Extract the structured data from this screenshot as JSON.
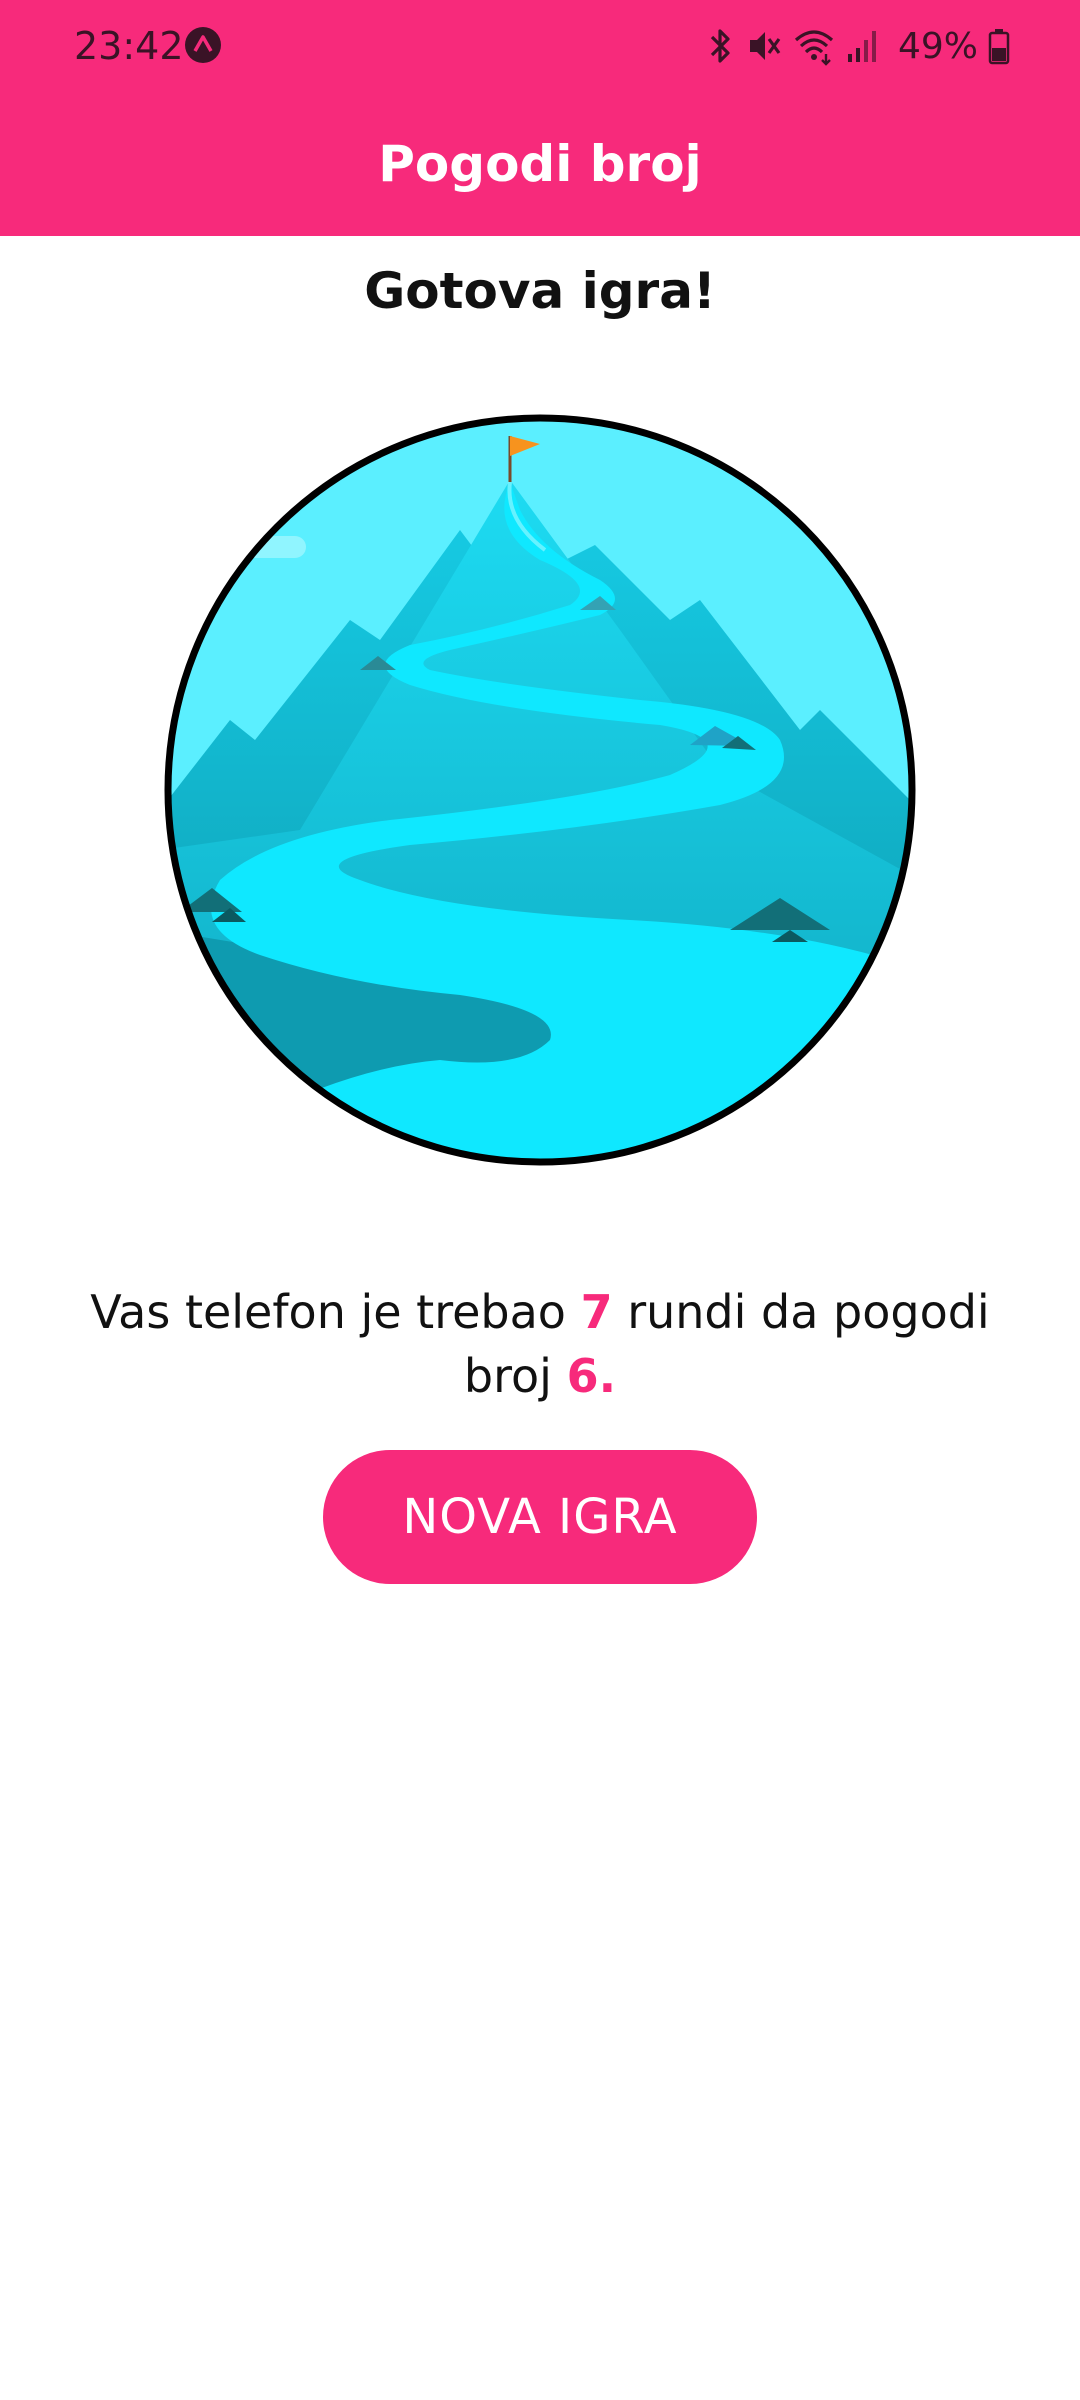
{
  "status_bar": {
    "time": "23:42",
    "battery": "49%",
    "icons": [
      "app-notification-icon",
      "bluetooth-icon",
      "mute-icon",
      "wifi-icon",
      "signal-icon",
      "battery-icon"
    ]
  },
  "app_bar": {
    "title": "Pogodi broj"
  },
  "screen": {
    "title": "Gotova igra!",
    "summary": {
      "part1": "Vas telefon je trebao ",
      "rounds": "7",
      "part2": " rundi da pogodi broj ",
      "number": "6."
    },
    "button_label": "NOVA IGRA"
  },
  "colors": {
    "primary": "#F72A7B",
    "sky": "#5BEFFF",
    "river": "#0FE8FF"
  }
}
